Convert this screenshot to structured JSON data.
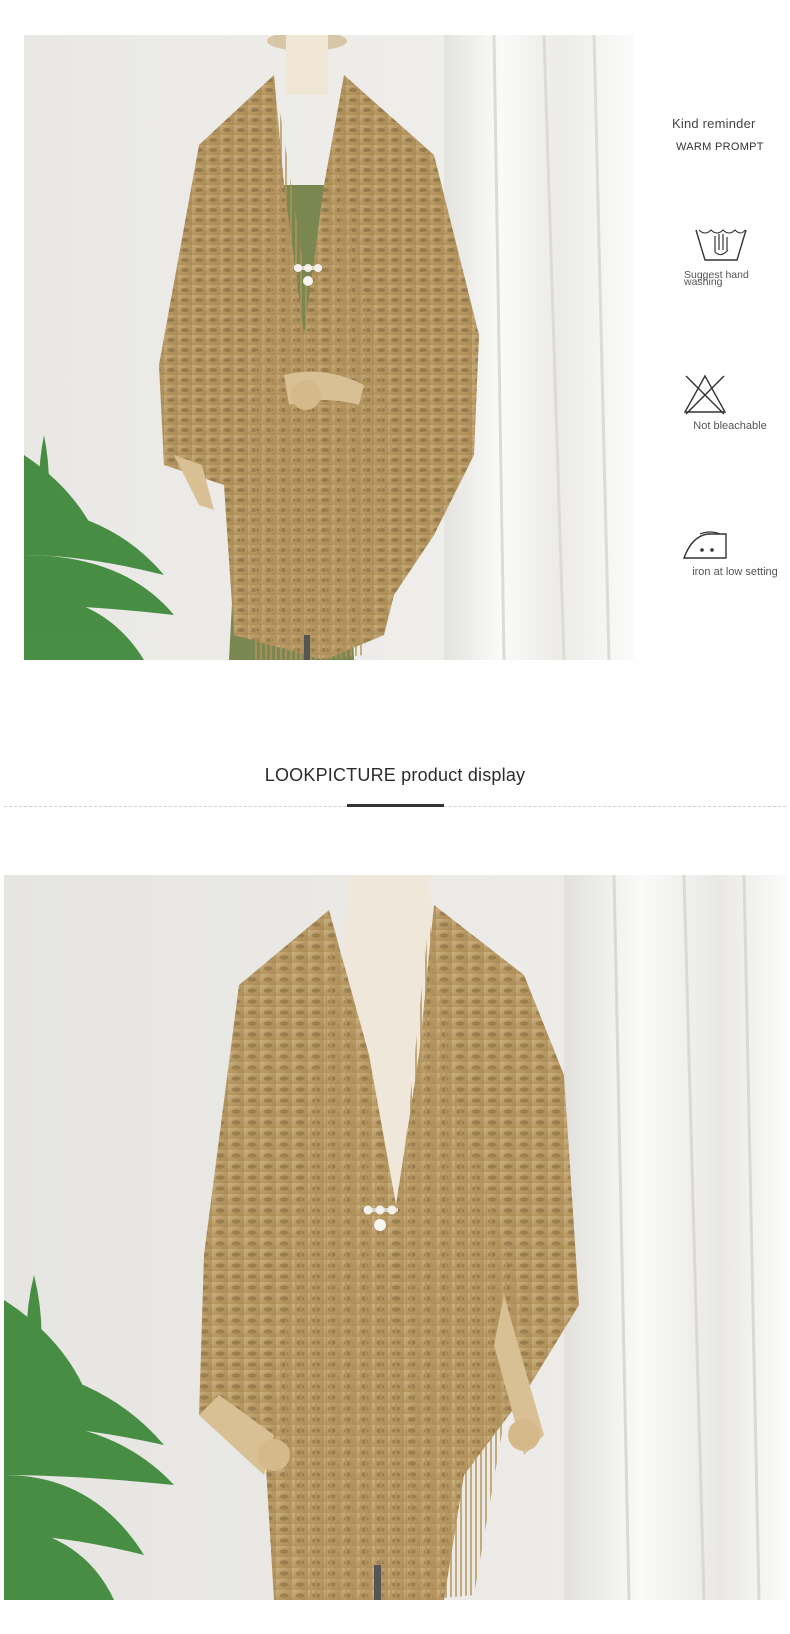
{
  "care": {
    "title": "Kind reminder",
    "subtitle": "WARM PROMPT",
    "items": [
      {
        "icon": "hand-wash-icon",
        "label": "Suggest hand washing"
      },
      {
        "icon": "no-bleach-icon",
        "label": "Not bleachable"
      },
      {
        "icon": "iron-low-icon",
        "label": "iron at low setting"
      }
    ]
  },
  "section": {
    "heading": "LOOKPICTURE product display"
  },
  "colors": {
    "shawl_gold": "#b99b6a",
    "background": "#ffffff",
    "wall": "#ecebe7",
    "curtain": "#f6f6f4",
    "leaf": "#3f8a3c"
  }
}
